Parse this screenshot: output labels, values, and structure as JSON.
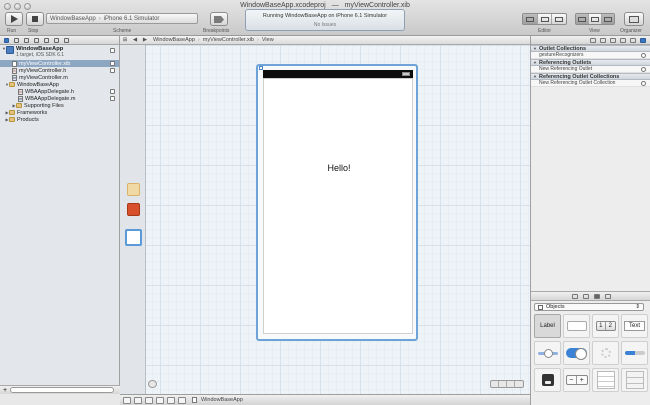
{
  "window": {
    "project_file": "WindowBaseApp.xcodeproj",
    "dash": "—",
    "open_file": "myViewController.xib"
  },
  "toolbar": {
    "run_label": "Run",
    "stop_label": "Stop",
    "scheme_label": "Scheme",
    "breakpoints_label": "Breakpoints",
    "editor_label": "Editor",
    "view_label": "View",
    "organizer_label": "Organizer",
    "scheme_app": "WindowBaseApp",
    "scheme_destination": "iPhone 6.1 Simulator",
    "activity_status": "Running WindowBaseApp on iPhone 6.1 Simulator",
    "activity_issues": "No Issues"
  },
  "navigator": {
    "project": {
      "name": "WindowBaseApp",
      "subtitle": "1 target, iOS SDK 6.1"
    },
    "items": [
      {
        "label": "myViewController.xib",
        "icon": "xib-file-icon",
        "indent": 1,
        "selected": true
      },
      {
        "label": "myViewController.h",
        "icon": "header-file-icon",
        "indent": 1
      },
      {
        "label": "myViewController.m",
        "icon": "implementation-file-icon",
        "indent": 1
      },
      {
        "label": "WindowBaseApp",
        "icon": "folder-icon",
        "indent": 0,
        "expanded": true
      },
      {
        "label": "WBAAppDelegate.h",
        "icon": "header-file-icon",
        "indent": 2
      },
      {
        "label": "WBAAppDelegate.m",
        "icon": "implementation-file-icon",
        "indent": 2
      },
      {
        "label": "Supporting Files",
        "icon": "folder-icon",
        "indent": 1
      },
      {
        "label": "Frameworks",
        "icon": "folder-icon",
        "indent": 0
      },
      {
        "label": "Products",
        "icon": "folder-icon",
        "indent": 0
      }
    ]
  },
  "jumpbar": {
    "crumbs": [
      "WindowBaseApp",
      "myViewController.xib",
      "View"
    ]
  },
  "canvas": {
    "label_text": "Hello!"
  },
  "debug": {
    "app_name": "WindowBaseApp"
  },
  "inspector": {
    "sections": [
      {
        "title": "Outlet Collections",
        "rows": [
          "gestureRecognizers"
        ]
      },
      {
        "title": "Referencing Outlets",
        "rows": [
          "New Referencing Outlet"
        ]
      },
      {
        "title": "Referencing Outlet Collections",
        "rows": [
          "New Referencing Outlet Collection"
        ]
      }
    ]
  },
  "library": {
    "selector": "Objects",
    "label_item": "Label",
    "text_field_item": "Text",
    "segment_1": "1",
    "segment_2": "2",
    "stepper_minus": "−",
    "stepper_plus": "+",
    "progress_fraction": 0.5
  },
  "colors": {
    "accent": "#3b78c2",
    "selection": "#8da6c2",
    "scene_border": "#6ea3d7",
    "placeholder_orange": "#d8502b"
  }
}
